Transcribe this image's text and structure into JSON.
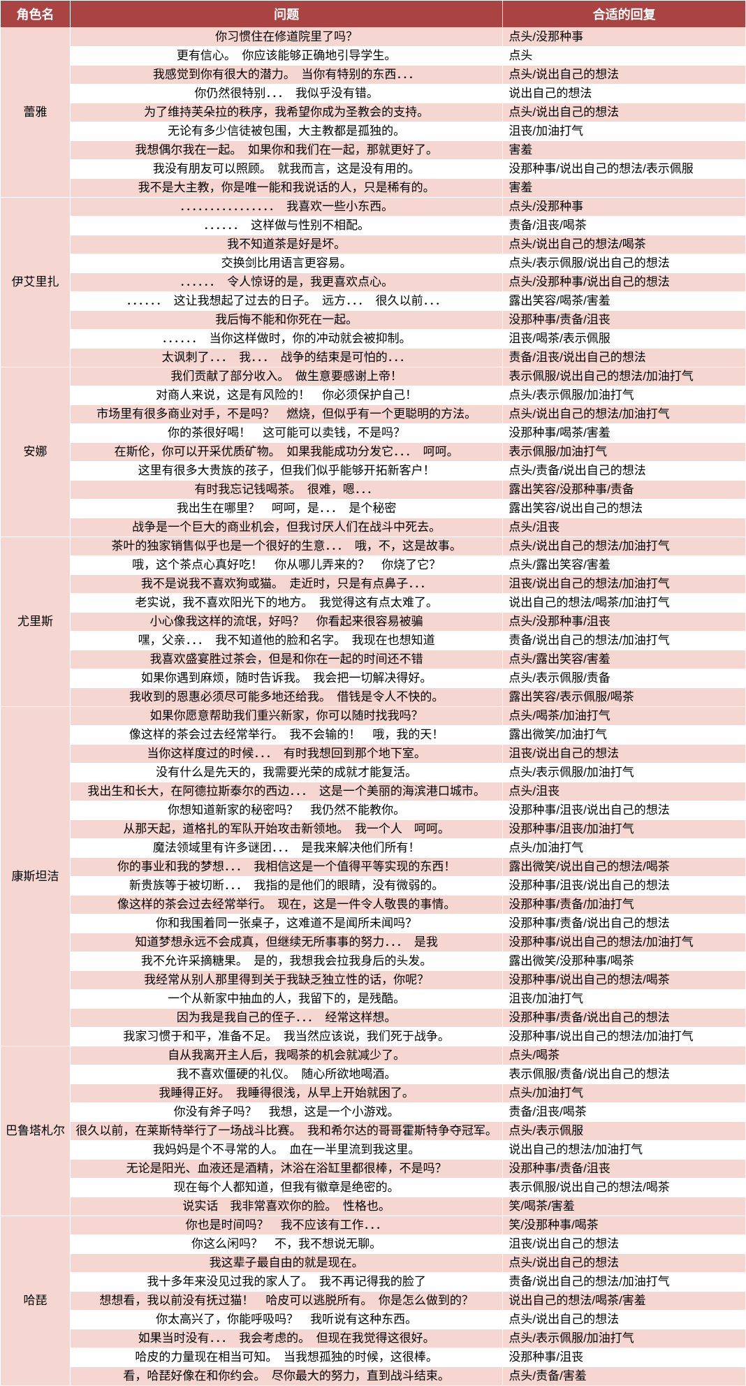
{
  "header": {
    "name": "角色名",
    "q": "问题",
    "a": "合适的回复"
  },
  "groups": [
    {
      "name": "蕾雅",
      "rows": [
        {
          "q": "你习惯住在修道院里了吗？",
          "a": "点头/没那种事"
        },
        {
          "q": "更有信心。　你应该能够正确地引导学生。",
          "a": "点头"
        },
        {
          "q": "我感觉到你有很大的潜力。　当你有特别的东西．．．",
          "a": "点头/说出自己的想法"
        },
        {
          "q": "你仍然很特别．．．　我似乎没有错。",
          "a": "说出自己的想法"
        },
        {
          "q": "为了维持芙朵拉的秩序，我希望你成为圣教会的支持。",
          "a": "点头/说出自己的想法"
        },
        {
          "q": "无论有多少信徒被包围，大主教都是孤独的。",
          "a": "沮丧/加油打气"
        },
        {
          "q": "我想偶尔我在一起。　如果你和我们在一起，那就更好了。",
          "a": "害羞"
        },
        {
          "q": "我没有朋友可以照顾。　就我而言，这是没有用的。",
          "a": "没那种事/说出自己的想法/表示佩服"
        },
        {
          "q": "我不是大主教，你是唯一能和我说话的人，只是稀有的。",
          "a": "害羞"
        }
      ]
    },
    {
      "name": "伊艾里扎",
      "rows": [
        {
          "q": "．．．．．．．．．．．．．．．．　我喜欢一些小东西。",
          "a": "点头/没那种事"
        },
        {
          "q": "．．．．．．　这样做与性别不相配。",
          "a": "责备/沮丧/喝茶"
        },
        {
          "q": "我不知道茶是好是坏。",
          "a": "点头/说出自己的想法/喝茶"
        },
        {
          "q": "交换剑比用语言更容易。",
          "a": "点头/表示佩服/说出自己的想法"
        },
        {
          "q": "．．．．．．　令人惊讶的是，我更喜欢点心。",
          "a": "点头/没那种事/说出自己的想法"
        },
        {
          "q": "．．．．．．　这让我想起了过去的日子。　远方．．．　很久以前．．．",
          "a": "露出笑容/喝茶/害羞"
        },
        {
          "q": "我后悔不能和你死在一起。",
          "a": "没那种事/责备/沮丧"
        },
        {
          "q": "．．．．．．　当你这样做时，你的冲动就会被抑制。",
          "a": "沮丧/喝茶/表示佩服"
        },
        {
          "q": "太讽刺了．．．　我．．．　战争的结束是可怕的．．．",
          "a": "责备/沮丧/说出自己的想法"
        }
      ]
    },
    {
      "name": "安娜",
      "rows": [
        {
          "q": "我们贡献了部分收入。　做生意要感谢上帝！",
          "a": "表示佩服/说出自己的想法/加油打气"
        },
        {
          "q": "对商人来说，这是有风险的！　你必须保护自己！",
          "a": "点头/表示佩服/加油打气"
        },
        {
          "q": "市场里有很多商业对手，不是吗？　燃烧，但似乎有一个更聪明的方法。",
          "a": "点头/说出自己的想法/加油打气"
        },
        {
          "q": "你的茶很好喝！　这可能可以卖钱，不是吗？",
          "a": "没那种事/喝茶/害羞"
        },
        {
          "q": "在斯伦，你可以开采优质矿物。　如果我能成功分发它．．．　呵呵。",
          "a": "表示佩服/加油打气"
        },
        {
          "q": "这里有很多大贵族的孩子，但我们似乎能够开拓新客户！",
          "a": "点头/责备/说出自己的想法"
        },
        {
          "q": "有时我忘记钱喝茶。　很难，嗯．．．",
          "a": "露出笑容/没那种事/责备"
        },
        {
          "q": "我出生在哪里？　呵呵，是．．．　是个秘密",
          "a": "露出笑容/说出自己的想法"
        },
        {
          "q": "战争是一个巨大的商业机会，但我讨厌人们在战斗中死去。",
          "a": "点头/沮丧"
        }
      ]
    },
    {
      "name": "尤里斯",
      "rows": [
        {
          "q": "茶叶的独家销售似乎也是一个很好的生意．．．　哦，不，这是故事。",
          "a": "点头/说出自己的想法/加油打气"
        },
        {
          "q": "哦，这个茶点心真好吃！　你从哪儿弄来的？　你烧了它？",
          "a": "点头/露出笑容/害羞"
        },
        {
          "q": "我不是说我不喜欢狗或猫。　走近时，只是有点鼻子．．．",
          "a": "沮丧/说出自己的想法/加油打气"
        },
        {
          "q": "老实说，我不喜欢阳光下的地方。　我觉得这有点太难了。",
          "a": "说出自己的想法/喝茶/加油打气"
        },
        {
          "q": "小心像我这样的流氓，好吗？　你看起来很容易被骗",
          "a": "点头/没那种事/沮丧"
        },
        {
          "q": "嘿，父亲．．．　我不知道他的脸和名字。　我现在也想知道",
          "a": "责备/说出自己的想法/加油打气"
        },
        {
          "q": "我喜欢盛宴胜过茶会，但是和你在一起的时间还不错",
          "a": "点头/露出笑容/害羞"
        },
        {
          "q": "如果你遇到麻烦，随时告诉我。　我会把一切解决得好。",
          "a": "点头/表示佩服/责备"
        },
        {
          "q": "我收到的恩惠必须尽可能多地还给我。　借钱是令人不快的。",
          "a": "露出笑容/表示佩服/喝茶"
        }
      ]
    },
    {
      "name": "康斯坦洁",
      "rows": [
        {
          "q": "如果你愿意帮助我们重兴新家，你可以随时找我吗？",
          "a": "点头/喝茶/加油打气"
        },
        {
          "q": "像这样的茶会过去经常举行。　我不会输的！　哦，我的天！",
          "a": "露出微笑/加油打气"
        },
        {
          "q": "当你这样度过的时候．．．　有时我想回到那个地下室。",
          "a": "沮丧/说出自己的想法"
        },
        {
          "q": "没有什么是先天的，我需要光荣的成就才能复活。",
          "a": "点头/表示佩服/加油打气"
        },
        {
          "q": "我出生和长大，在阿德拉斯泰尔的西边．．．　这是一个美丽的海滨港口城市。",
          "a": "点头/沮丧"
        },
        {
          "q": "你想知道新家的秘密吗？　我仍然不能教你。",
          "a": "没那种事/沮丧/说出自己的想法"
        },
        {
          "q": "从那天起，道格扎的军队开始攻击新领地。　我一个人　呵呵。",
          "a": "没那种事/沮丧/加油打气"
        },
        {
          "q": "魔法领域里有许多谜团．．．　是我来解决他们所有！",
          "a": "点头/加油打气"
        },
        {
          "q": "你的事业和我的梦想．．．　我相信这是一个值得平等实现的东西！",
          "a": "露出微笑/说出自己的想法/喝茶"
        },
        {
          "q": "新贵族等于被切断．．．　我指的是他们的眼睛，没有微弱的。",
          "a": "没那种事/沮丧/说出自己的想法"
        },
        {
          "q": "像这样的茶会过去经常举行。　现在，这是一件令人敬畏的事情。",
          "a": "没那种事/责备/加油打气"
        },
        {
          "q": "你和我围着同一张桌子，这难道不是闻所未闻吗？",
          "a": "没那种事/责备/说出自己的想法"
        },
        {
          "q": "知道梦想永远不会成真，但继续无所事事的努力．．．　是我",
          "a": "没那种事/说出自己的想法/加油打气"
        },
        {
          "q": "我不允许采摘糖果。　是的，我想我会拉我身后的头发。",
          "a": "露出微笑/没那种事/喝茶"
        },
        {
          "q": "我经常从别人那里得到关于我缺乏独立性的话，你呢？",
          "a": "没那种事/说出自己的想法/喝茶"
        },
        {
          "q": "一个从新家中抽血的人，我留下的，是残酷。",
          "a": "沮丧/加油打气"
        },
        {
          "q": "因为我是我自己的侄子．．．　经常这样想。",
          "a": "没那种事/责备/说出自己的想法"
        },
        {
          "q": "我家习惯于和平，准备不足。　我当然应该说，我们死于战争。",
          "a": "没那种事/说出自己的想法/加油打气"
        }
      ]
    },
    {
      "name": "巴鲁塔札尔",
      "rows": [
        {
          "q": "自从我离开主人后，我喝茶的机会就减少了。",
          "a": "点头/喝茶"
        },
        {
          "q": "我不喜欢僵硬的礼仪。　随心所欲地喝酒。",
          "a": "表示佩服/责备/说出自己的想法"
        },
        {
          "q": "我睡得正好。　我睡得很浅，从早上开始就困了。",
          "a": "点头/加油打气"
        },
        {
          "q": "你没有斧子吗？　我想，这是一个小游戏。",
          "a": "责备/沮丧/喝茶"
        },
        {
          "q": "很久以前，在莱斯特举行了一场战斗比赛。　我和希尔达的哥哥霍斯特争夺冠军。",
          "a": "点头/表示佩服"
        },
        {
          "q": "我妈妈是个不寻常的人。　血在一半里流到我这里。",
          "a": "说出自己的想法/加油打气"
        },
        {
          "q": "无论是阳光、血液还是酒精，沐浴在浴缸里都很棒，不是吗？",
          "a": "没那种事/责备/沮丧"
        },
        {
          "q": "现在每个人都知道，但我有徽章是绝密的。",
          "a": "表示佩服/说出自己的想法/喝茶"
        },
        {
          "q": "说实话　我非常喜欢你的脸。　性格也。",
          "a": "笑/喝茶/害羞"
        }
      ]
    },
    {
      "name": "哈琵",
      "rows": [
        {
          "q": "你也是时间吗？　我不应该有工作．．．",
          "a": "笑/没那种事/喝茶"
        },
        {
          "q": "你这么闲吗？　不，我不想说无聊。",
          "a": "沮丧/说出自己的想法"
        },
        {
          "q": "我这辈子最自由的就是现在。",
          "a": "点头/说出自己的想法"
        },
        {
          "q": "我十多年来没见过我的家人了。　我不再记得我的脸了",
          "a": "责备/说出自己的想法/加油打气"
        },
        {
          "q": "想想看，我以前没有抚过猫！　哈皮可以逃脱所有。　你是怎么做到的？",
          "a": "说出自己的想法/喝茶/害羞"
        },
        {
          "q": "你太高兴了，你能呼吸吗？　我听说有这种东西。",
          "a": "点头/说出自己的想法"
        },
        {
          "q": "如果当时没有．．．　我会考虑的。　但现在我觉得这很好。",
          "a": "点头/表示佩服/加油打气"
        },
        {
          "q": "哈皮的力量现在相当可知。　当我想孤独的时候，这很棒。",
          "a": "没那种事/沮丧"
        },
        {
          "q": "看，哈琵好像在和你约会。　尽你最大的努力，直到战斗结束。",
          "a": "点头/责备/害羞"
        }
      ]
    }
  ]
}
